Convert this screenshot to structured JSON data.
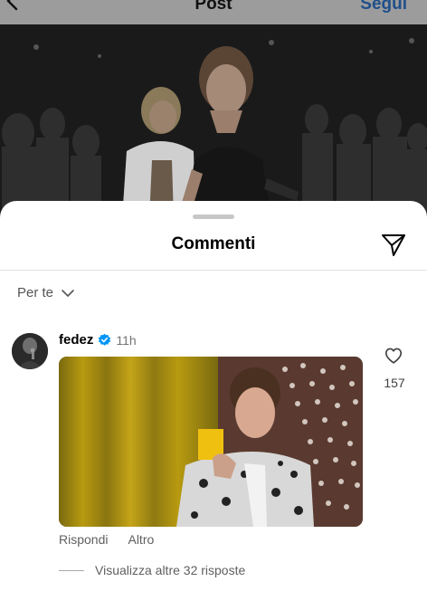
{
  "header": {
    "title": "Post",
    "follow_label": "Segui"
  },
  "sheet": {
    "title": "Commenti",
    "sort_label": "Per te"
  },
  "comment": {
    "username": "fedez",
    "verified": true,
    "time": "11h",
    "like_count": "157",
    "reply_label": "Rispondi",
    "more_label": "Altro",
    "view_replies_label": "Visualizza altre 32 risposte"
  },
  "colors": {
    "verified_blue": "#0095f6",
    "card_yellow": "#f0c010",
    "curtain_yellow": "#b89a10",
    "secondary_text": "#737373"
  },
  "icons": {
    "back": "back-arrow-icon",
    "send": "send-icon",
    "sort": "chevron-down-icon",
    "verified": "verified-badge-icon",
    "like": "heart-icon"
  }
}
